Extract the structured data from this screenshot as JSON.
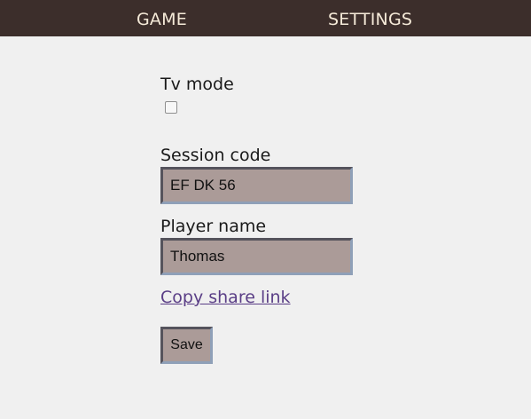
{
  "nav": {
    "tabs": [
      {
        "label": "GAME"
      },
      {
        "label": "SETTINGS"
      }
    ]
  },
  "settings": {
    "tv_mode_label": "Tv mode",
    "tv_mode_checked": false,
    "session_code_label": "Session code",
    "session_code_value": "EF DK 56",
    "player_name_label": "Player name",
    "player_name_value": "Thomas",
    "copy_link_label": "Copy share link",
    "save_label": "Save"
  },
  "colors": {
    "topbar_bg": "#3c2e2b",
    "nav_text": "#f5ead8",
    "field_bg": "#ab9b98",
    "link": "#5a3e86",
    "page_bg": "#f0f0f0"
  }
}
